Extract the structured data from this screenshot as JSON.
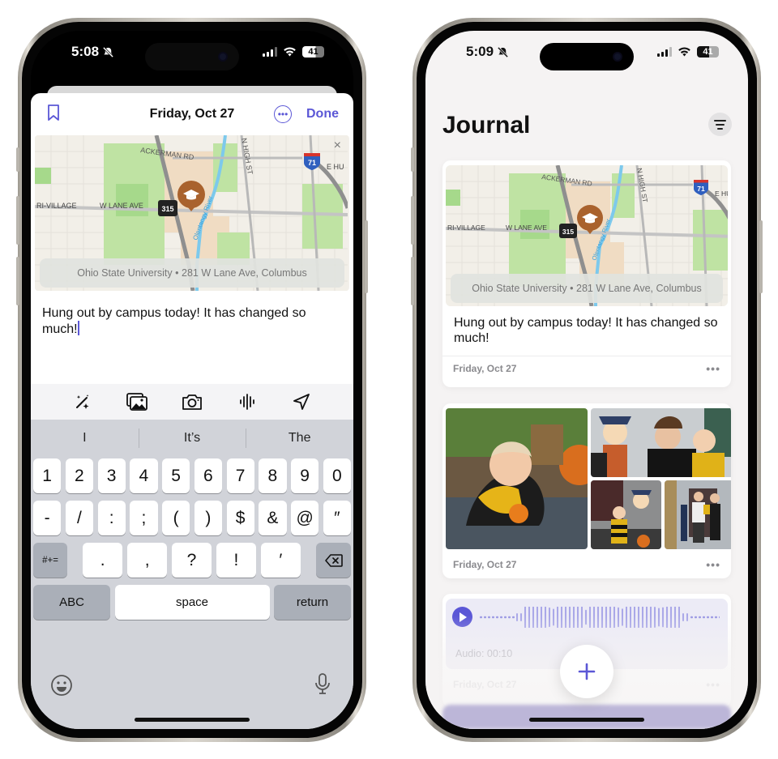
{
  "left_phone": {
    "status": {
      "time": "5:08",
      "battery": "41"
    },
    "header": {
      "title": "Friday, Oct 27",
      "done_label": "Done"
    },
    "map": {
      "labels": {
        "road1": "ACKERMAN RD",
        "road2": "N HIGH ST",
        "area": "RI-VILLAGE",
        "road3": "W LANE AVE",
        "route": "315",
        "interstate": "71",
        "road4": "E HU",
        "river": "Olentangy River"
      },
      "place": "Ohio State University",
      "separator": "•",
      "address": "281 W Lane Ave, Columbus",
      "close_label": "×"
    },
    "entry_text": "Hung out by campus today! It has changed so much!",
    "toolbar": [
      {
        "icon": "magic-wand-icon"
      },
      {
        "icon": "photo-library-icon"
      },
      {
        "icon": "camera-icon"
      },
      {
        "icon": "audio-waveform-icon"
      },
      {
        "icon": "location-arrow-icon"
      }
    ],
    "keyboard": {
      "suggestions": [
        "I",
        "It’s",
        "The"
      ],
      "row1": [
        "1",
        "2",
        "3",
        "4",
        "5",
        "6",
        "7",
        "8",
        "9",
        "0"
      ],
      "row2": [
        "-",
        "/",
        ":",
        ";",
        "(",
        ")",
        "$",
        "&",
        "@",
        "″"
      ],
      "row3": {
        "shift": "#+=",
        "keys": [
          ".",
          ",",
          "?",
          "!",
          "′"
        ]
      },
      "row4": {
        "abc": "ABC",
        "space": "space",
        "return": "return"
      }
    }
  },
  "right_phone": {
    "status": {
      "time": "5:09",
      "battery": "41"
    },
    "title": "Journal",
    "entries": [
      {
        "type": "map",
        "place": "Ohio State University",
        "separator": "•",
        "address": "281 W Lane Ave, Columbus",
        "text": "Hung out by campus today! It has changed so much!",
        "date": "Friday, Oct 27",
        "more": "•••"
      },
      {
        "type": "photos",
        "photo_count": 4,
        "date": "Friday, Oct 27",
        "more": "•••"
      },
      {
        "type": "audio",
        "audio_label": "Audio: 00:10",
        "date": "Friday, Oct 27",
        "more": "•••"
      }
    ],
    "fab_label": "+"
  },
  "colors": {
    "accent": "#5b57d6",
    "map_pin": "#a9622d",
    "keyboard_bg": "#d1d3d9",
    "audio_bg": "#ecebf6",
    "journal_bg": "#f5f3f3"
  }
}
